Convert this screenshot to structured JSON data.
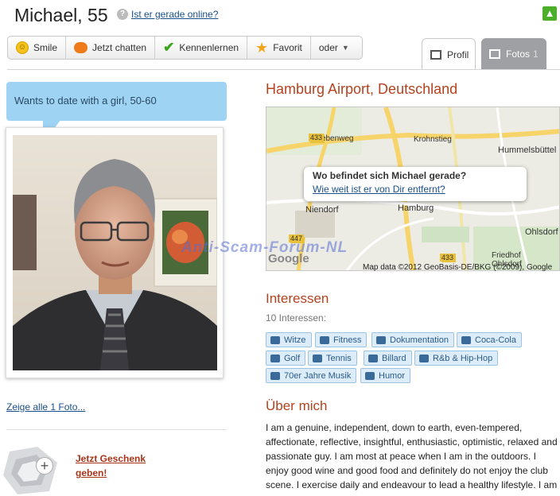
{
  "header": {
    "name_age": "Michael, 55",
    "help_glyph": "?",
    "online_link": "Ist er gerade online?"
  },
  "toolbar": {
    "smile": "Smile",
    "chat": "Jetzt chatten",
    "meet": "Kennenlernen",
    "favorite": "Favorit",
    "more": "oder"
  },
  "tabs": {
    "profil": "Profil",
    "fotos": "Fotos",
    "fotos_count": "1"
  },
  "left": {
    "bubble": "Wants to date with a girl, 50-60",
    "show_photos": "Zeige alle 1 Foto...",
    "gift_line1": "Jetzt Geschenk",
    "gift_line2": "geben!"
  },
  "location": {
    "title": "Hamburg Airport, Deutschland",
    "popup_question": "Wo befindet sich Michael gerade?",
    "popup_link": "Wie weit ist er von Dir entfernt?",
    "map_credit": "Map data ©2012 GeoBasis-DE/BKG (©2009), Google",
    "google_logo": "Google",
    "map_labels": [
      "Swebenweg",
      "Krohnstieg",
      "Hummelsbüttel",
      "Niendorf",
      "Hamburg",
      "Ohlsdorf",
      "Friedhof",
      "Ohlsdorf",
      "433",
      "433",
      "447",
      "433"
    ]
  },
  "watermark": "Anti-Scam-Forum-NL",
  "interests": {
    "heading": "Interessen",
    "count": "10 Interessen:",
    "tags": [
      "Witze",
      "Fitness",
      "Dokumentation",
      "Coca-Cola",
      "Golf",
      "Tennis",
      "Billard",
      "R&b & Hip-Hop",
      "70er Jahre Musik",
      "Humor"
    ]
  },
  "about": {
    "heading": "Über mich",
    "text": "I am a genuine, independent, down to earth, even-tempered, affectionate, reflective, insightful, enthusiastic, optimistic, relaxed and passionate guy. I am most at peace when I am in the outdoors. I enjoy good wine and good food and definitely do not enjoy the club scene. I exercise daily and endeavour to lead a healthy lifestyle. I am a"
  }
}
